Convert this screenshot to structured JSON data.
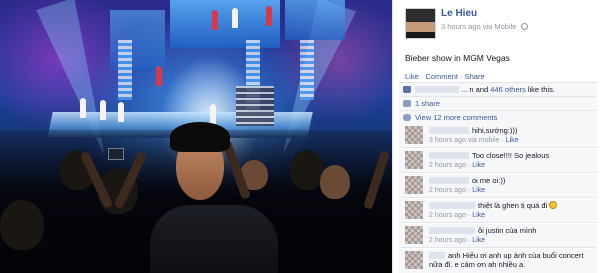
{
  "post": {
    "author": "Le Hieu",
    "time": "3 hours ago via Mobile",
    "status": "Bieber show in MGM Vegas",
    "actions": {
      "like": "Like",
      "comment": "Comment",
      "share": "Share",
      "separator": " · "
    }
  },
  "ufi": {
    "likes_prefix": "... n and",
    "likes_link": "446 others",
    "likes_suffix": "like this.",
    "shares": "1 share",
    "view_more": "View 12 more comments"
  },
  "comments": [
    {
      "text": "hihi,sướng:)))",
      "meta": "3 hours ago via mobile",
      "like": "Like"
    },
    {
      "text": "Too close!!!! So jealous",
      "meta": "2 hours ago",
      "like": "Like"
    },
    {
      "text": "oi me oi:))",
      "meta": "2 hours ago",
      "like": "Like"
    },
    {
      "text": "thiệt là ghen tị quá đi",
      "meta": "2 hours ago",
      "like": "Like"
    },
    {
      "text": "ôi justin của mình",
      "meta": "2 hours ago",
      "like": "Like"
    },
    {
      "text": "anh Hiếu ơi anh up ảnh của buổi concert nữa đi. e cám ơn ah nhiều a.",
      "meta": "",
      "like": ""
    }
  ],
  "icons": [
    "globe-icon",
    "like-icon",
    "share-icon",
    "comment-icon",
    "smile-emoticon-icon"
  ],
  "colors": {
    "link": "#3b5998",
    "meta": "#9197a3",
    "ufi_bg": "#f6f7f9"
  }
}
